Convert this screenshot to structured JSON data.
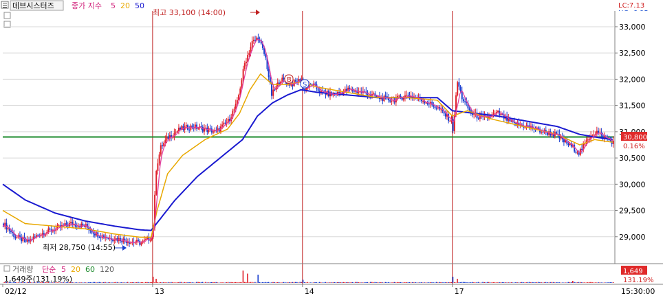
{
  "header": {
    "ticker": "데브시스터즈",
    "ma_label": "종가 지수",
    "ma_periods": [
      "5",
      "20",
      "50"
    ],
    "lc": "LC:7.13",
    "hc": "HC:-6.95"
  },
  "annotations": {
    "high": "최고 33,100 (14:00)",
    "low": "최저 28,750 (14:55)",
    "buy_marker": "B",
    "sell_marker": "S"
  },
  "current": {
    "price": "30,800",
    "change": "0.16%",
    "volume": "1,649",
    "volume_pct": "131.19%"
  },
  "volume_panel": {
    "title": "거래량",
    "ma_label": "단순",
    "ma_periods": [
      "5",
      "20",
      "60",
      "120"
    ],
    "readout": "1,649주(131.19%)"
  },
  "time_axis": {
    "labels": [
      "02/12",
      "13",
      "14",
      "17"
    ],
    "end_time": "15:30:00"
  },
  "colors": {
    "up": "#e0202a",
    "down": "#1a3fd0",
    "ma5": "#e040a0",
    "ma20": "#e8a800",
    "ma50": "#1a1ad0",
    "hline": "#1a8a2a",
    "session": "#c02020"
  },
  "chart_data": {
    "type": "candlestick",
    "ylim": [
      28500,
      33300
    ],
    "yticks": [
      "29,000",
      "29,500",
      "30,000",
      "30,500",
      "31,000",
      "31,500",
      "32,000",
      "32,500",
      "33,000"
    ],
    "horizontal_line": 30900,
    "sessions": [
      "02/12",
      "13",
      "14",
      "17"
    ],
    "price_path": [
      [
        0,
        29250
      ],
      [
        8,
        29000
      ],
      [
        16,
        28900
      ],
      [
        24,
        29050
      ],
      [
        35,
        29150
      ],
      [
        45,
        29250
      ],
      [
        55,
        29200
      ],
      [
        62,
        29050
      ],
      [
        70,
        28980
      ],
      [
        78,
        28950
      ],
      [
        86,
        28900
      ],
      [
        92,
        28880
      ],
      [
        99,
        29000
      ],
      [
        100,
        29200
      ],
      [
        102,
        30300
      ],
      [
        105,
        30700
      ],
      [
        110,
        30900
      ],
      [
        118,
        31050
      ],
      [
        126,
        31100
      ],
      [
        134,
        31050
      ],
      [
        142,
        31000
      ],
      [
        150,
        31200
      ],
      [
        156,
        31550
      ],
      [
        161,
        32300
      ],
      [
        166,
        32700
      ],
      [
        170,
        32800
      ],
      [
        175,
        32400
      ],
      [
        179,
        31700
      ],
      [
        185,
        32000
      ],
      [
        192,
        31900
      ],
      [
        199,
        32000
      ],
      [
        200,
        31800
      ],
      [
        206,
        31900
      ],
      [
        212,
        31750
      ],
      [
        220,
        31700
      ],
      [
        230,
        31800
      ],
      [
        240,
        31750
      ],
      [
        250,
        31650
      ],
      [
        260,
        31600
      ],
      [
        270,
        31700
      ],
      [
        280,
        31600
      ],
      [
        290,
        31450
      ],
      [
        299,
        31200
      ],
      [
        300,
        31050
      ],
      [
        303,
        31950
      ],
      [
        306,
        31650
      ],
      [
        312,
        31350
      ],
      [
        320,
        31250
      ],
      [
        330,
        31350
      ],
      [
        340,
        31150
      ],
      [
        350,
        31100
      ],
      [
        360,
        31000
      ],
      [
        368,
        30950
      ],
      [
        375,
        30800
      ],
      [
        380,
        30700
      ],
      [
        384,
        30600
      ],
      [
        388,
        30750
      ],
      [
        392,
        30950
      ],
      [
        396,
        31000
      ],
      [
        400,
        30900
      ],
      [
        404,
        30850
      ],
      [
        407,
        30800
      ]
    ],
    "ma50_path": [
      [
        0,
        30000
      ],
      [
        15,
        29700
      ],
      [
        35,
        29450
      ],
      [
        55,
        29300
      ],
      [
        75,
        29200
      ],
      [
        92,
        29130
      ],
      [
        99,
        29120
      ],
      [
        104,
        29300
      ],
      [
        115,
        29700
      ],
      [
        130,
        30150
      ],
      [
        145,
        30500
      ],
      [
        160,
        30850
      ],
      [
        170,
        31300
      ],
      [
        180,
        31550
      ],
      [
        190,
        31700
      ],
      [
        199,
        31800
      ],
      [
        210,
        31750
      ],
      [
        230,
        31700
      ],
      [
        250,
        31650
      ],
      [
        270,
        31650
      ],
      [
        290,
        31650
      ],
      [
        300,
        31400
      ],
      [
        315,
        31350
      ],
      [
        330,
        31300
      ],
      [
        350,
        31200
      ],
      [
        370,
        31100
      ],
      [
        385,
        30950
      ],
      [
        395,
        30900
      ],
      [
        407,
        30850
      ]
    ],
    "ma20_path": [
      [
        0,
        29500
      ],
      [
        15,
        29250
      ],
      [
        35,
        29200
      ],
      [
        55,
        29150
      ],
      [
        75,
        29050
      ],
      [
        92,
        28990
      ],
      [
        99,
        28990
      ],
      [
        103,
        29500
      ],
      [
        110,
        30200
      ],
      [
        120,
        30550
      ],
      [
        135,
        30850
      ],
      [
        150,
        31050
      ],
      [
        158,
        31350
      ],
      [
        165,
        31800
      ],
      [
        172,
        32100
      ],
      [
        180,
        31900
      ],
      [
        190,
        31900
      ],
      [
        199,
        31950
      ],
      [
        210,
        31850
      ],
      [
        230,
        31750
      ],
      [
        250,
        31650
      ],
      [
        270,
        31650
      ],
      [
        290,
        31600
      ],
      [
        300,
        31300
      ],
      [
        310,
        31400
      ],
      [
        325,
        31250
      ],
      [
        340,
        31150
      ],
      [
        355,
        31050
      ],
      [
        370,
        30950
      ],
      [
        385,
        30750
      ],
      [
        395,
        30850
      ],
      [
        407,
        30800
      ]
    ],
    "volume_spikes": [
      [
        100,
        6
      ],
      [
        102,
        4
      ],
      [
        160,
        12
      ],
      [
        163,
        9
      ],
      [
        170,
        8
      ],
      [
        200,
        3
      ],
      [
        300,
        6
      ],
      [
        303,
        4
      ],
      [
        380,
        2
      ]
    ]
  }
}
